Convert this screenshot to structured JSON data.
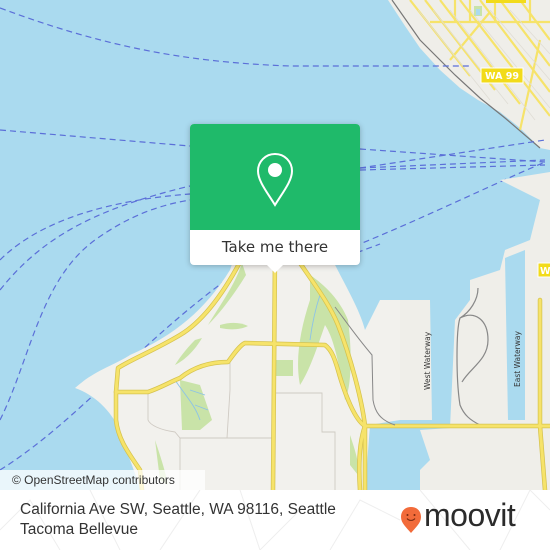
{
  "map": {
    "attribution": "© OpenStreetMap contributors",
    "road_shields": [
      "WA 99",
      "WA"
    ],
    "water_labels": [
      "West Waterway",
      "East Waterway"
    ],
    "colors": {
      "water": "#aadaef",
      "land": "#f2f1ed",
      "park": "#c9e3a8",
      "major_road": "#f6e36a",
      "ferry_route": "#5b6fd8",
      "shield": "#f2db1a"
    }
  },
  "popup": {
    "icon": "location-pin-icon",
    "button_label": "Take me there",
    "color": "#1fba6a"
  },
  "footer": {
    "address": "California Ave SW, Seattle, WA 98116, Seattle Tacoma Bellevue",
    "brand": "moovit",
    "brand_color": "#f26b3a"
  }
}
